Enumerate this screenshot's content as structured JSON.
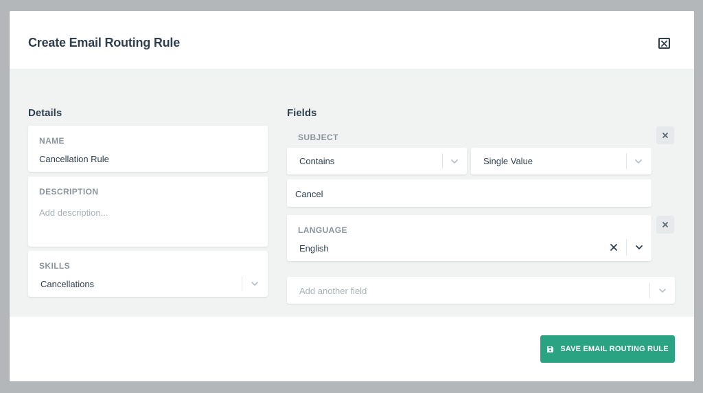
{
  "modal": {
    "title": "Create Email Routing Rule",
    "close_icon": "close-icon"
  },
  "details": {
    "heading": "Details",
    "name": {
      "label": "NAME",
      "value": "Cancellation Rule"
    },
    "description": {
      "label": "DESCRIPTION",
      "placeholder": "Add description..."
    },
    "skills": {
      "label": "SKILLS",
      "value": "Cancellations"
    }
  },
  "fields": {
    "heading": "Fields",
    "subject": {
      "label": "SUBJECT",
      "operator": "Contains",
      "value_type": "Single Value",
      "value": "Cancel"
    },
    "language": {
      "label": "LANGUAGE",
      "value": "English"
    },
    "add_field_placeholder": "Add another field"
  },
  "footer": {
    "save_label": "SAVE EMAIL ROUTING RULE",
    "save_icon": "floppy-disk-icon"
  },
  "colors": {
    "accent": "#2aa382",
    "body_bg": "#f1f3f3",
    "text": "#2f3f4e",
    "label": "#8a949c"
  }
}
